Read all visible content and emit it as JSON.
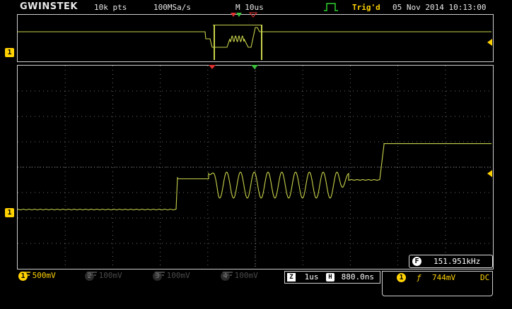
{
  "header": {
    "brand": "GWINSTEK",
    "record_length": "10k pts",
    "sample_rate": "100MSa/s",
    "timebase": "M 10us",
    "trigger_status": "Trig'd",
    "datetime": "05 Nov 2014 10:13:00"
  },
  "markers": {
    "ch1": "1"
  },
  "frequency": {
    "icon": "F",
    "value": "151.951kHz"
  },
  "channels": [
    {
      "id": "1",
      "scale": "500mV"
    },
    {
      "id": "2",
      "scale": "100mV"
    },
    {
      "id": "3",
      "scale": "100mV"
    },
    {
      "id": "4",
      "scale": "100mV"
    }
  ],
  "zoom": {
    "icon": "Z",
    "scale": "1us",
    "h_icon": "H",
    "position": "880.0ns"
  },
  "trigger": {
    "source": "1",
    "slope": "ƒ",
    "level": "744mV",
    "coupling": "DC"
  },
  "colors": {
    "trace": "#c8d24a",
    "ch1": "#ffd200",
    "grid": "#6b6b6b",
    "marker_red": "#e03030",
    "marker_green": "#3cc23c"
  }
}
